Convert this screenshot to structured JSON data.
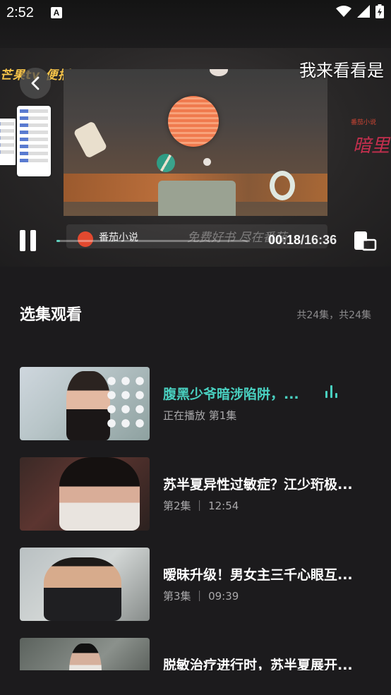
{
  "status_bar": {
    "time": "2:52",
    "notification_icon": "A"
  },
  "player": {
    "caption": "我来看看是",
    "brand_tag": "芒果tv 便播",
    "side_logo": "番茄小说",
    "side_title": "暗里着迷",
    "banner_app": "番茄小说",
    "banner_slogan": "免费好书 尽在番茄",
    "time_current": "00:18",
    "time_total": "/16:36",
    "progress": 0.018,
    "accent_color": "#5fd3c0"
  },
  "episodes_section": {
    "title": "选集观看",
    "count": "共24集，共24集"
  },
  "episodes": [
    {
      "title": "腹黑少爷暗涉陷阱，...",
      "meta": "正在播放 第1集",
      "playing": true
    },
    {
      "title": "苏半夏异性过敏症？江少珩极...",
      "meta": "第2集 ｜ 12:54",
      "playing": false
    },
    {
      "title": "暧昧升级！男女主三千心眼互...",
      "meta": "第3集 ｜ 09:39",
      "playing": false
    },
    {
      "title": "脱敏治疗进行时，苏半夏展开...",
      "meta": "",
      "playing": false
    }
  ]
}
